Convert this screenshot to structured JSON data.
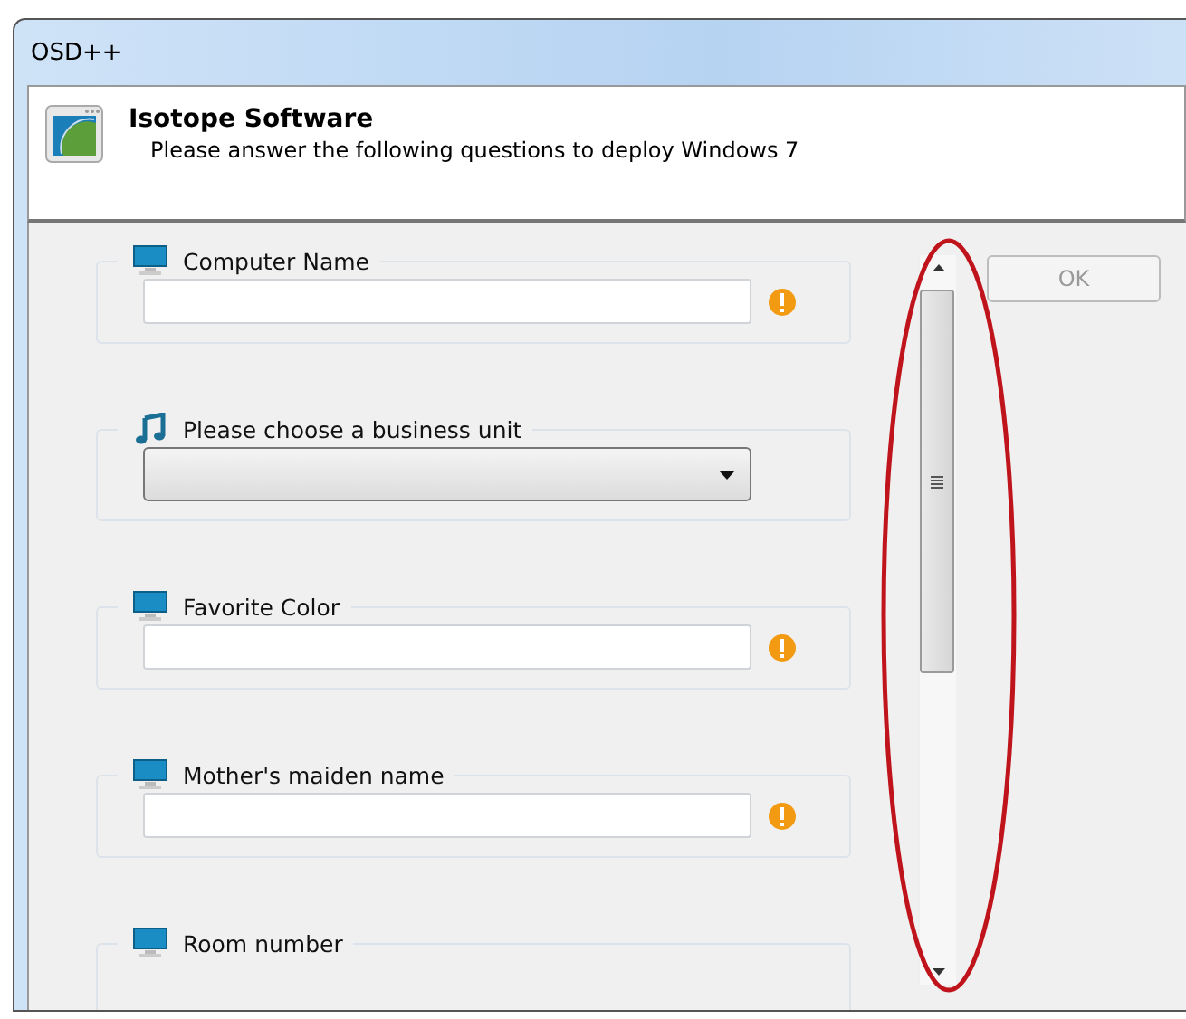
{
  "window": {
    "title": "OSD++"
  },
  "header": {
    "title": "Isotope Software",
    "subtitle": "Please answer the following questions to deploy Windows 7"
  },
  "fields": [
    {
      "label": "Computer Name",
      "kind": "text",
      "warning": true
    },
    {
      "label": "Please choose a business unit",
      "kind": "dropdown",
      "warning": false
    },
    {
      "label": "Favorite Color",
      "kind": "text",
      "warning": true
    },
    {
      "label": "Mother's maiden name",
      "kind": "text",
      "warning": true
    },
    {
      "label": "Room number",
      "kind": "cut"
    }
  ],
  "ok_button": {
    "label": "OK",
    "disabled": true
  },
  "annotation": {
    "kind": "ellipse"
  }
}
